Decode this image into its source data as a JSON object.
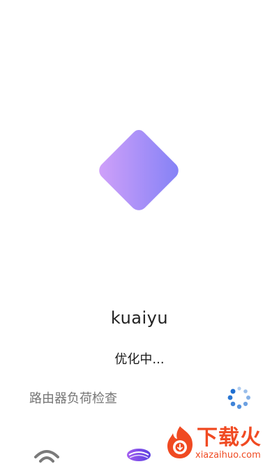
{
  "app": {
    "name": "kuaiyu",
    "logo_icon": "purple-diamond-logo",
    "logo_gradient": [
      "#c48ef8",
      "#8a83f7"
    ]
  },
  "status": {
    "text": "优化中..."
  },
  "task": {
    "label": "路由器负荷检查",
    "spinner_icon": "loading-spinner-icon",
    "spinner_color": "#1f6fd1"
  },
  "bottom_icons": [
    {
      "name": "wifi-icon"
    },
    {
      "name": "router-icon"
    }
  ],
  "watermark": {
    "brand": "下载火",
    "url": "xiazaihuo.com",
    "color": "#f04a22"
  }
}
